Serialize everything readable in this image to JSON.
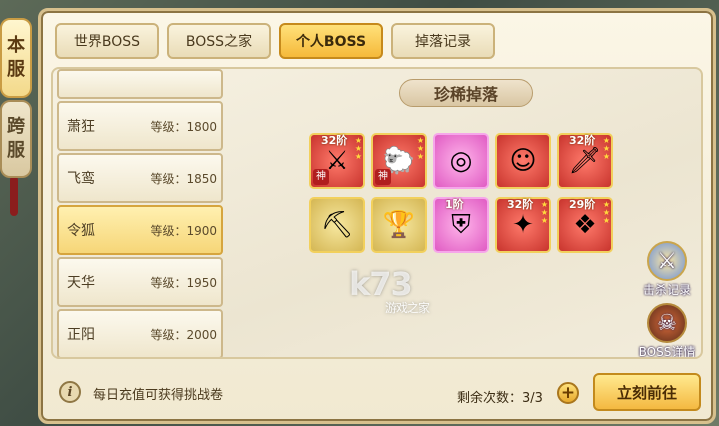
{
  "server_tabs": [
    {
      "label": "本\n服",
      "active": true
    },
    {
      "label": "跨\n服",
      "active": false
    }
  ],
  "top_tabs": [
    {
      "label": "世界BOSS",
      "active": false
    },
    {
      "label": "BOSS之家",
      "active": false
    },
    {
      "label": "个人BOSS",
      "active": true
    },
    {
      "label": "掉落记录",
      "active": false
    }
  ],
  "boss_list": [
    {
      "name": "萧狂",
      "level": "等级：1800",
      "selected": false
    },
    {
      "name": "飞鸾",
      "level": "等级：1850",
      "selected": false
    },
    {
      "name": "令狐",
      "level": "等级：1900",
      "selected": true
    },
    {
      "name": "天华",
      "level": "等级：1950",
      "selected": false
    },
    {
      "name": "正阳",
      "level": "等级：2000",
      "selected": false
    }
  ],
  "drops": {
    "title": "珍稀掉落",
    "items": [
      {
        "icon": "purple-blade-icon",
        "glyph": "⚔",
        "rarity": "red",
        "tier": "32阶",
        "stars": 3,
        "seal": "神"
      },
      {
        "icon": "sheep-pet-icon",
        "glyph": "🐑",
        "rarity": "red",
        "tier": "",
        "stars": 3,
        "seal": "神"
      },
      {
        "icon": "jade-ring-icon",
        "glyph": "◎",
        "rarity": "pink",
        "tier": "",
        "stars": 0,
        "seal": ""
      },
      {
        "icon": "fox-girl-icon",
        "glyph": "☺",
        "rarity": "red",
        "tier": "",
        "stars": 0,
        "seal": ""
      },
      {
        "icon": "emerald-sword-icon",
        "glyph": "🗡",
        "rarity": "red",
        "tier": "32阶",
        "stars": 3,
        "seal": ""
      },
      {
        "icon": "stone-anvil-icon",
        "glyph": "⛏",
        "rarity": "gold",
        "tier": "",
        "stars": 0,
        "seal": ""
      },
      {
        "icon": "bronze-chalice-icon",
        "glyph": "🏆",
        "rarity": "gold",
        "tier": "",
        "stars": 0,
        "seal": ""
      },
      {
        "icon": "golden-armor-icon",
        "glyph": "⛨",
        "rarity": "pink",
        "tier": "1阶",
        "stars": 0,
        "seal": ""
      },
      {
        "icon": "violet-spear-icon",
        "glyph": "✦",
        "rarity": "red",
        "tier": "32阶",
        "stars": 3,
        "seal": ""
      },
      {
        "icon": "winged-mount-icon",
        "glyph": "❖",
        "rarity": "red",
        "tier": "29阶",
        "stars": 3,
        "seal": ""
      }
    ]
  },
  "side_buttons": {
    "kills_label": "击杀记录",
    "details_label": "BOSS详情"
  },
  "footer": {
    "tip": "每日充值可获得挑战卷",
    "remaining": "剩余次数：3/3",
    "go_button": "立刻前往"
  },
  "watermark": {
    "main": "k73",
    "sub": "游戏之家"
  },
  "colors": {
    "accent": "#f5b93a",
    "panel": "#fbf6e6"
  }
}
